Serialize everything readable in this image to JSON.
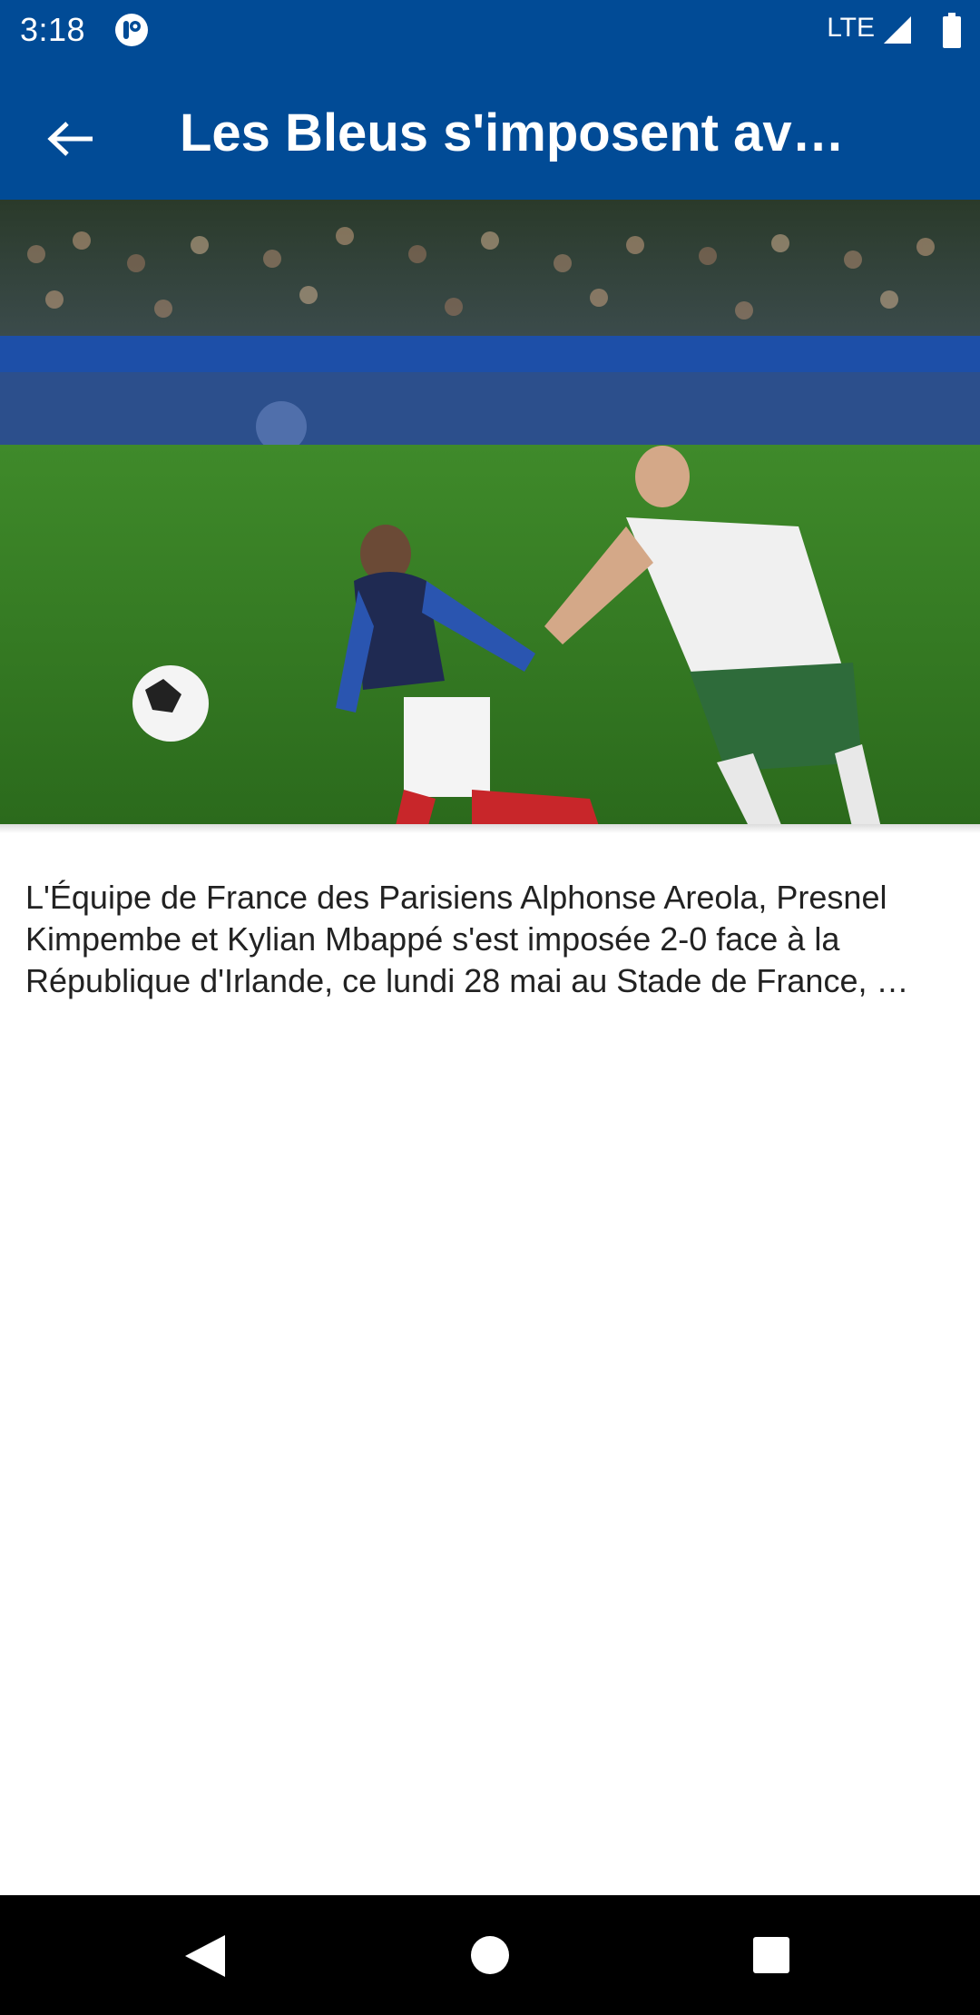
{
  "status_bar": {
    "time": "3:18",
    "network": "LTE",
    "app_icon": "parisfans-app-icon",
    "signal_icon": "cell-signal-icon",
    "battery_icon": "battery-icon"
  },
  "app_bar": {
    "title": "Les Bleus s'imposent av…",
    "back_icon": "arrow-left-icon",
    "background_color": "#014b96"
  },
  "article": {
    "hero_image": "football match photo: France player in navy jersey number 10 dribbling past Ireland player in white and green number 21",
    "summary": "L'Équipe de France des Parisiens Alphonse Areola, Presnel Kimpembe et Kylian Mbappé s'est imposée 2-0 face à la République d'Irlande, ce lundi 28 mai au Stade de France, …"
  },
  "nav_bar": {
    "back_icon": "triangle-back-icon",
    "home_icon": "circle-home-icon",
    "recents_icon": "square-recents-icon"
  }
}
